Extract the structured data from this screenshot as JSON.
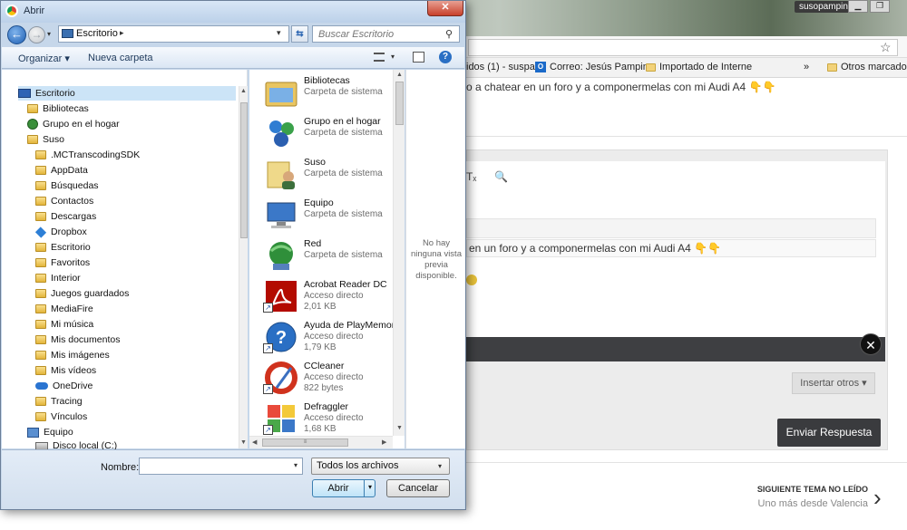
{
  "browser": {
    "user_name": "susopampin",
    "bookmarks": [
      {
        "label": "idos (1) - suspa"
      },
      {
        "label": "Correo: Jesús Pampin"
      },
      {
        "label": "Importado de Interne"
      },
      {
        "label": "»"
      },
      {
        "label": "Otros marcadores"
      }
    ],
    "topic_line": "o a chatear en un foro y a componermelas con mi Audi A4 👇👇",
    "quote_line": "en un foro y a componermelas con mi Audi A4 👇👇",
    "insert_button": "Insertar otros ▾",
    "send_button": "Enviar Respuesta",
    "next_topic_label": "SIGUIENTE TEMA NO LEÍDO",
    "next_topic_title": "Uno más desde Valencia"
  },
  "dialog": {
    "title": "Abrir",
    "address": "Escritorio",
    "search_placeholder": "Buscar Escritorio",
    "organize": "Organizar ▾",
    "new_folder": "Nueva carpeta",
    "tree": [
      {
        "label": "Escritorio"
      },
      {
        "label": "Bibliotecas"
      },
      {
        "label": "Grupo en el hogar"
      },
      {
        "label": "Suso"
      },
      {
        "label": ".MCTranscodingSDK"
      },
      {
        "label": "AppData"
      },
      {
        "label": "Búsquedas"
      },
      {
        "label": "Contactos"
      },
      {
        "label": "Descargas"
      },
      {
        "label": "Dropbox"
      },
      {
        "label": "Escritorio"
      },
      {
        "label": "Favoritos"
      },
      {
        "label": "Interior"
      },
      {
        "label": "Juegos guardados"
      },
      {
        "label": "MediaFire"
      },
      {
        "label": "Mi música"
      },
      {
        "label": "Mis documentos"
      },
      {
        "label": "Mis imágenes"
      },
      {
        "label": "Mis vídeos"
      },
      {
        "label": "OneDrive"
      },
      {
        "label": "Tracing"
      },
      {
        "label": "Vínculos"
      },
      {
        "label": "Equipo"
      },
      {
        "label": "Disco local (C:)"
      }
    ],
    "files": [
      {
        "name": "Bibliotecas",
        "type": "Carpeta de sistema",
        "size": ""
      },
      {
        "name": "Grupo en el hogar",
        "type": "Carpeta de sistema",
        "size": ""
      },
      {
        "name": "Suso",
        "type": "Carpeta de sistema",
        "size": ""
      },
      {
        "name": "Equipo",
        "type": "Carpeta de sistema",
        "size": ""
      },
      {
        "name": "Red",
        "type": "Carpeta de sistema",
        "size": ""
      },
      {
        "name": "Acrobat Reader DC",
        "type": "Acceso directo",
        "size": "2,01 KB"
      },
      {
        "name": "Ayuda de PlayMemories",
        "type": "Acceso directo",
        "size": "1,79 KB"
      },
      {
        "name": "CCleaner",
        "type": "Acceso directo",
        "size": "822 bytes"
      },
      {
        "name": "Defraggler",
        "type": "Acceso directo",
        "size": "1,68 KB"
      }
    ],
    "preview_text": "No hay ninguna vista previa disponible.",
    "filename_label": "Nombre:",
    "filename_value": "",
    "filter_value": "Todos los archivos",
    "open_button": "Abrir",
    "cancel_button": "Cancelar"
  }
}
